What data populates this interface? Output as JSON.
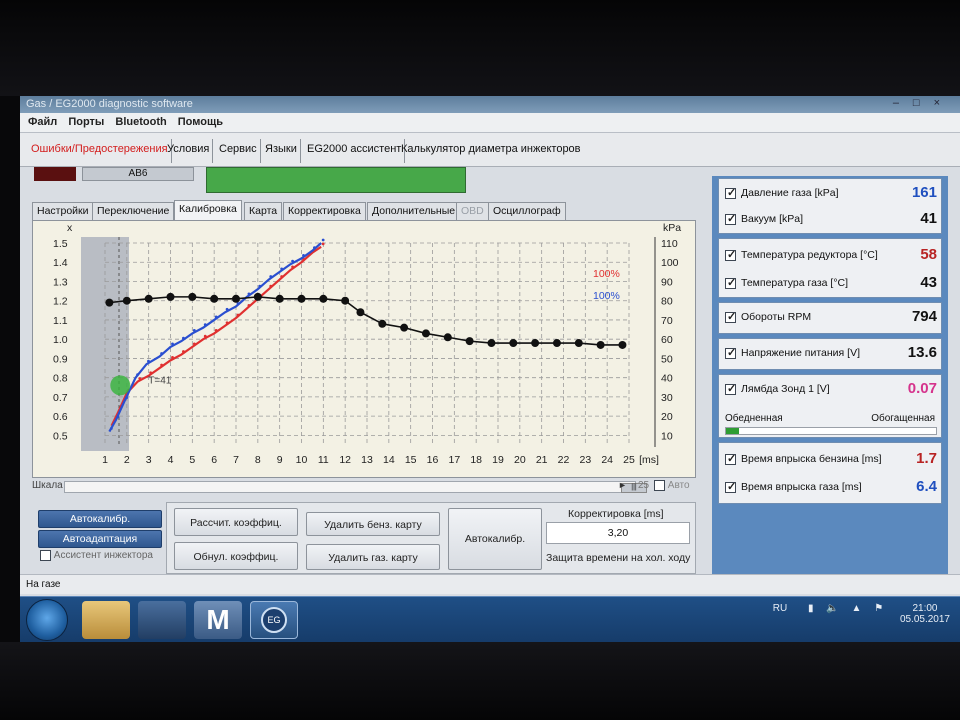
{
  "app": {
    "title": "Gas / EG2000 diagnostic software",
    "menu": [
      "Файл",
      "Порты",
      "Bluetooth",
      "Помощь"
    ]
  },
  "toolbar": {
    "items": [
      "Ошибки/Предостережения",
      "Условия",
      "Сервис",
      "Языки",
      "EG2000 ассистент",
      "Калькулятор диаметра инжекторов"
    ]
  },
  "upper": {
    "abs_label": "АВ6"
  },
  "tabs": [
    {
      "label": "Настройки",
      "active": false
    },
    {
      "label": "Переключение",
      "active": false
    },
    {
      "label": "Калибровка",
      "active": true
    },
    {
      "label": "Карта",
      "active": false
    },
    {
      "label": "Корректировка",
      "active": false
    },
    {
      "label": "Дополнительные",
      "active": false
    },
    {
      "label": "OBD",
      "active": false,
      "disabled": true
    },
    {
      "label": "Осциллограф",
      "active": false
    }
  ],
  "chart_data": {
    "type": "line",
    "left_axis": {
      "label": "x",
      "ticks": [
        "1.5",
        "1.4",
        "1.3",
        "1.2",
        "1.1",
        "1.0",
        "0.9",
        "0.8",
        "0.7",
        "0.6",
        "0.5"
      ],
      "range": [
        0.45,
        1.5
      ]
    },
    "right_axis": {
      "label": "kPa",
      "ticks": [
        "110",
        "100",
        "90",
        "80",
        "70",
        "60",
        "50",
        "40",
        "30",
        "20",
        "10"
      ],
      "range": [
        5,
        110
      ]
    },
    "x_axis": {
      "label": "[ms]",
      "ticks": [
        "1",
        "2",
        "3",
        "4",
        "5",
        "6",
        "7",
        "8",
        "9",
        "10",
        "11",
        "12",
        "13",
        "14",
        "15",
        "16",
        "17",
        "18",
        "19",
        "20",
        "21",
        "22",
        "23",
        "24",
        "25"
      ],
      "range": [
        1,
        25
      ]
    },
    "legend": [
      {
        "name": "100%",
        "color": "#e03030"
      },
      {
        "name": "100%",
        "color": "#2a4fd0"
      }
    ],
    "marker_text": "T=41",
    "current_point": {
      "x": 1.7,
      "y": 36
    },
    "series": [
      {
        "color": "#e03030",
        "points": [
          [
            1.3,
            15
          ],
          [
            1.6,
            22
          ],
          [
            2.0,
            32
          ],
          [
            2.5,
            38
          ],
          [
            3,
            41
          ],
          [
            3.5,
            45
          ],
          [
            4,
            49
          ],
          [
            4.5,
            52
          ],
          [
            5,
            56
          ],
          [
            5.5,
            60
          ],
          [
            6,
            63
          ],
          [
            6.5,
            67
          ],
          [
            7,
            71
          ],
          [
            7.5,
            76
          ],
          [
            8,
            81
          ],
          [
            8.5,
            86
          ],
          [
            9,
            91
          ],
          [
            9.5,
            96
          ],
          [
            10,
            100
          ],
          [
            10.5,
            105
          ],
          [
            10.9,
            108
          ]
        ]
      },
      {
        "color": "#2a4fd0",
        "points": [
          [
            1.2,
            12
          ],
          [
            1.5,
            18
          ],
          [
            1.9,
            28
          ],
          [
            2.4,
            40
          ],
          [
            2.9,
            47
          ],
          [
            3.5,
            51
          ],
          [
            4,
            56
          ],
          [
            4.5,
            59
          ],
          [
            5,
            63
          ],
          [
            5.5,
            66
          ],
          [
            6,
            70
          ],
          [
            6.5,
            74
          ],
          [
            7,
            77
          ],
          [
            7.5,
            82
          ],
          [
            8,
            86
          ],
          [
            8.5,
            91
          ],
          [
            9,
            95
          ],
          [
            9.5,
            99
          ],
          [
            10,
            102
          ],
          [
            10.5,
            106
          ],
          [
            10.9,
            110
          ]
        ]
      },
      {
        "color": "#111111",
        "points": [
          [
            1.2,
            79
          ],
          [
            2,
            80
          ],
          [
            3,
            81
          ],
          [
            4,
            82
          ],
          [
            5,
            82
          ],
          [
            6,
            81
          ],
          [
            7,
            81
          ],
          [
            8,
            82
          ],
          [
            9,
            81
          ],
          [
            10,
            81
          ],
          [
            11,
            81
          ],
          [
            12,
            80
          ],
          [
            12.7,
            74
          ],
          [
            13.7,
            68
          ],
          [
            14.7,
            66
          ],
          [
            15.7,
            63
          ],
          [
            16.7,
            61
          ],
          [
            17.7,
            59
          ],
          [
            18.7,
            58
          ],
          [
            19.7,
            58
          ],
          [
            20.7,
            58
          ],
          [
            21.7,
            58
          ],
          [
            22.7,
            58
          ],
          [
            23.7,
            57
          ],
          [
            24.7,
            57
          ]
        ]
      }
    ]
  },
  "scrollbar": {
    "label": "Шкала",
    "value": "25",
    "auto_label": "Авто"
  },
  "buttons": {
    "autocalib": "Автокалибр.",
    "autoadapt": "Автоадаптация",
    "injector_assist": "Ассистент инжектора",
    "calc_coef": "Рассчит. коэффиц.",
    "delete_petrol_map": "Удалить бенз. карту",
    "reset_coef": "Обнул. коэффиц.",
    "delete_gas_map": "Удалить газ. карту",
    "autocalib_big": "Автокалибр."
  },
  "correction": {
    "label": "Корректировка [ms]",
    "value": "3,20",
    "idle_label": "Защита времени на хол. ходу"
  },
  "status": {
    "text": "На газе"
  },
  "readings": [
    {
      "label": "Давление газа [kPa]",
      "value": "161",
      "color": "#1f4fbf"
    },
    {
      "label": "Вакуум [kPa]",
      "value": "41",
      "color": "#111111"
    },
    {
      "label": "Температура редуктора [°C]",
      "value": "58",
      "color": "#b82323"
    },
    {
      "label": "Температура газа [°C]",
      "value": "43",
      "color": "#111111"
    },
    {
      "label": "Обороты RPM",
      "value": "794",
      "color": "#111111"
    },
    {
      "label": "Напряжение питания [V]",
      "value": "13.6",
      "color": "#111111"
    },
    {
      "label": "Лямбда Зонд 1 [V]",
      "value": "0.07",
      "color": "#d5338c"
    },
    {
      "label": "Время впрыска бензина [ms]",
      "value": "1.7",
      "color": "#b82323"
    },
    {
      "label": "Время впрыска газа [ms]",
      "value": "6.4",
      "color": "#1f4fbf"
    }
  ],
  "lambda": {
    "lean": "Обедненная",
    "rich": "Обогащенная",
    "level": 0.06
  },
  "taskbar": {
    "lang": "RU",
    "time": "21:00",
    "date": "05.05.2017"
  }
}
